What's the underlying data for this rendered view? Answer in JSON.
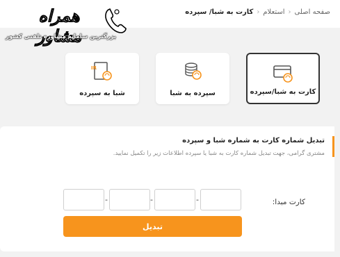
{
  "breadcrumb": {
    "home": "صفحه اصلی",
    "inquiry": "استعلام",
    "current": "کارت به شبا/ سپرده"
  },
  "logo": {
    "title": "همراه مشاور",
    "subtitle": "بزرگترین سامانه مشاوره تلفنی کشور"
  },
  "options": [
    {
      "label": "کارت به شبا/سپرده",
      "icon": "card-icon",
      "active": true
    },
    {
      "label": "سپرده به شبا",
      "icon": "coins-exchange-icon",
      "active": false
    },
    {
      "label": "شبا به سپرده",
      "icon": "iban-document-icon",
      "active": false
    }
  ],
  "form": {
    "title": "تبدیل شماره کارت به شماره شبا و سپرده",
    "description": "مشتری گرامی، جهت تبدیل شماره کارت به شبا یا سپرده اطلاعات زیر را تکمیل نمایید.",
    "card_label": "کارت مبدا:",
    "segments": [
      "",
      "",
      "",
      ""
    ],
    "separator": "-",
    "submit_label": "تبدیل"
  },
  "colors": {
    "accent": "#f7941d",
    "background": "#f2f2f2"
  }
}
